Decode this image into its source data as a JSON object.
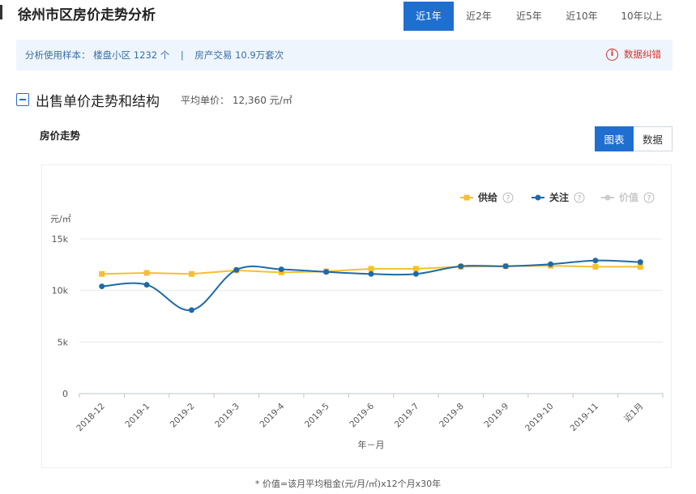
{
  "header": {
    "title": "徐州市区房价走势分析",
    "range_tabs": [
      "近1年",
      "近2年",
      "近5年",
      "近10年",
      "10年以上"
    ],
    "active_range": 0
  },
  "info": {
    "sample_label": "分析使用样本：",
    "sample_value": "楼盘小区 1232 个",
    "separator": "|",
    "trade_value": "房产交易 10.9万套次",
    "correction_label": "数据纠错"
  },
  "section": {
    "title": "出售单价走势和结构",
    "avg_price_label": "平均单价：",
    "avg_price_value": "12,360 元/㎡"
  },
  "chart_section": {
    "subtitle": "房价走势",
    "view_buttons": [
      "图表",
      "数据"
    ],
    "active_view": 0
  },
  "chart_data": {
    "type": "line",
    "ylabel": "元/㎡",
    "xlabel": "年－月",
    "ylim": [
      0,
      15000
    ],
    "yticks": [
      0,
      5000,
      10000,
      15000
    ],
    "ytick_labels": [
      "0",
      "5k",
      "10k",
      "15k"
    ],
    "categories": [
      "2018-12",
      "2019-1",
      "2019-2",
      "2019-3",
      "2019-4",
      "2019-5",
      "2019-6",
      "2019-7",
      "2019-8",
      "2019-9",
      "2019-10",
      "2019-11",
      "近1月"
    ],
    "grid": true,
    "legend_position": "top-right",
    "series": [
      {
        "name": "供给",
        "color": "#f5c02f",
        "marker": "square",
        "smooth": false,
        "visible": true,
        "values": [
          11600,
          11700,
          11600,
          11950,
          11750,
          11850,
          12100,
          12100,
          12300,
          12350,
          12400,
          12300,
          12300
        ]
      },
      {
        "name": "关注",
        "color": "#1e6aa8",
        "marker": "circle",
        "smooth": true,
        "visible": true,
        "values": [
          10400,
          10550,
          8100,
          12000,
          12050,
          11800,
          11600,
          11600,
          12350,
          12350,
          12550,
          12900,
          12750
        ]
      },
      {
        "name": "价值",
        "color": "#cccccc",
        "marker": "circle",
        "smooth": false,
        "visible": false,
        "values": []
      }
    ]
  },
  "footnote": "* 价值=该月平均租金(元/月/㎡)x12个月x30年"
}
